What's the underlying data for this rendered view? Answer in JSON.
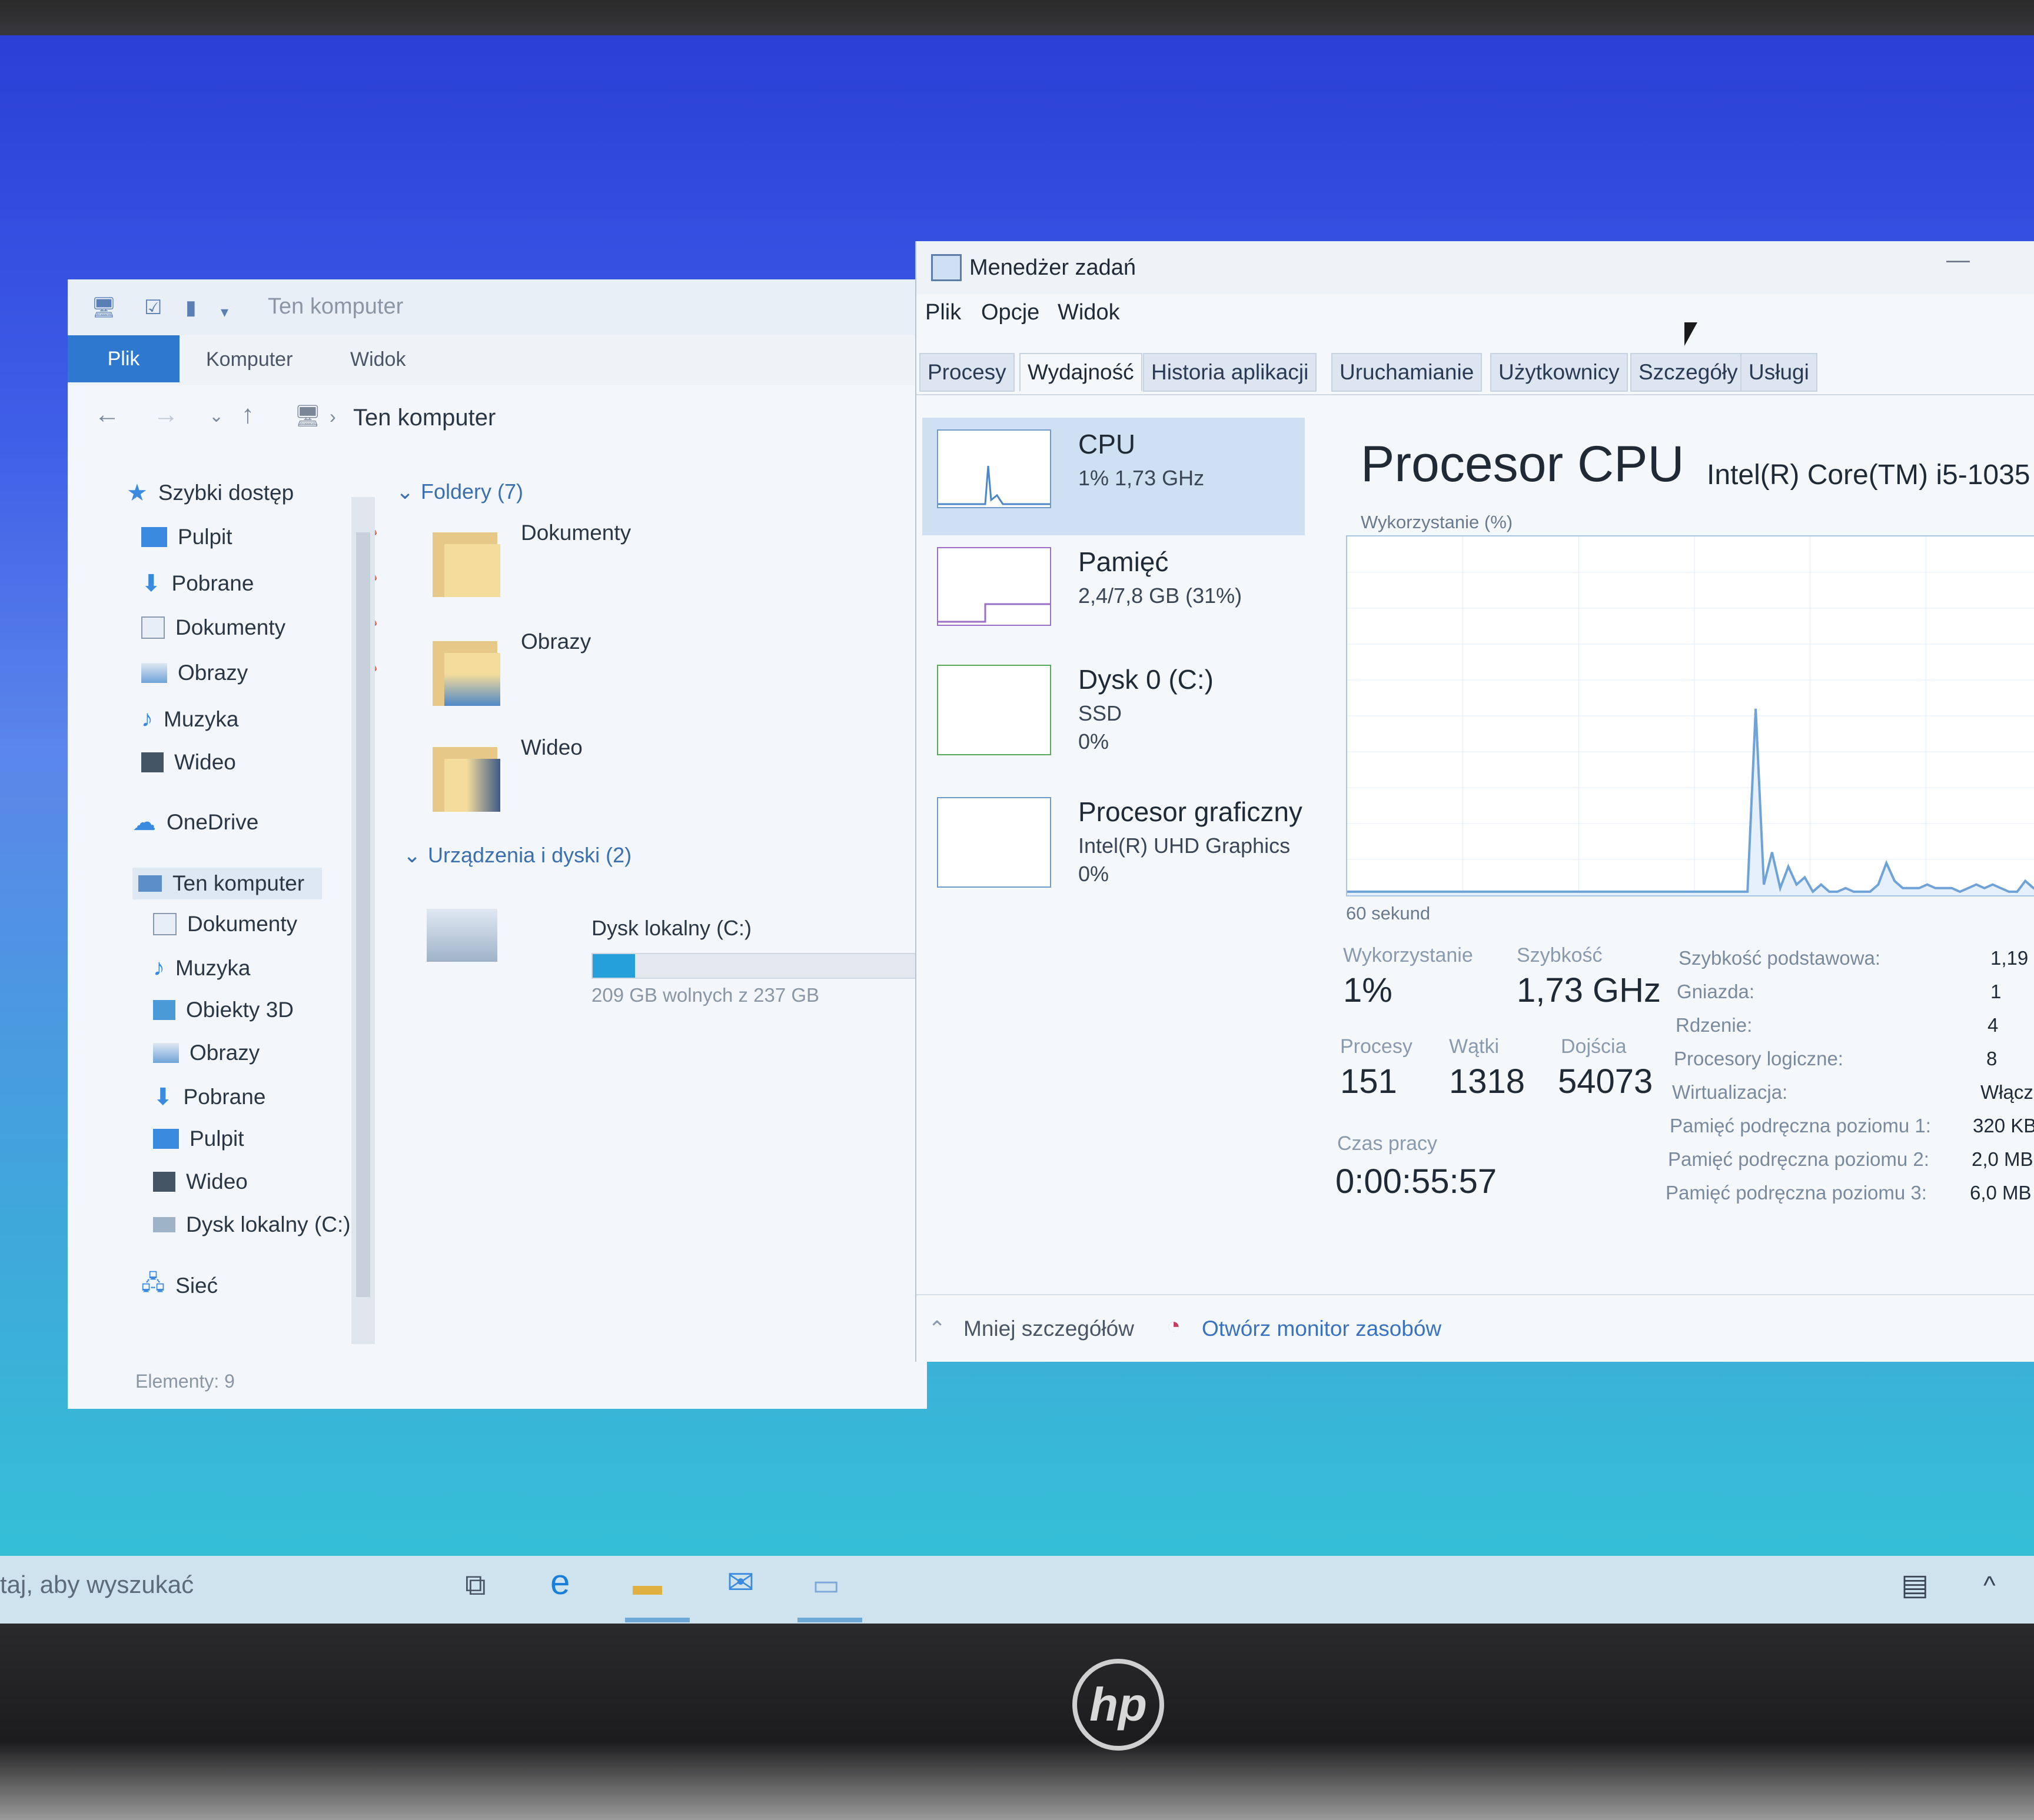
{
  "explorer": {
    "title": "Ten komputer",
    "ribbon_tabs": [
      "Plik",
      "Komputer",
      "Widok"
    ],
    "address_path": "Ten komputer",
    "sidebar": {
      "quick_access": "Szybki dostęp",
      "quick_items": [
        "Pulpit",
        "Pobrane",
        "Dokumenty",
        "Obrazy",
        "Muzyka",
        "Wideo"
      ],
      "onedrive": "OneDrive",
      "this_pc": "Ten komputer",
      "pc_items": [
        "Dokumenty",
        "Muzyka",
        "Obiekty 3D",
        "Obrazy",
        "Pobrane",
        "Pulpit",
        "Wideo",
        "Dysk lokalny (C:)"
      ],
      "network": "Sieć"
    },
    "folders_header": "Foldery (7)",
    "folders": [
      "Dokumenty",
      "Obrazy",
      "Wideo"
    ],
    "devices_header": "Urządzenia i dyski (2)",
    "drive_name": "Dysk lokalny (C:)",
    "drive_free": "209 GB wolnych z 237 GB",
    "drive_used_fraction": 0.12,
    "status": "Elementy: 9"
  },
  "taskmgr": {
    "title": "Menedżer zadań",
    "menu": [
      "Plik",
      "Opcje",
      "Widok"
    ],
    "tabs": [
      "Procesy",
      "Wydajność",
      "Historia aplikacji",
      "Uruchamianie",
      "Użytkownicy",
      "Szczegóły",
      "Usługi"
    ],
    "active_tab": "Wydajność",
    "resources": [
      {
        "name": "CPU",
        "line1": "1% 1,73 GHz",
        "line2": ""
      },
      {
        "name": "Pamięć",
        "line1": "2,4/7,8 GB (31%)",
        "line2": ""
      },
      {
        "name": "Dysk 0 (C:)",
        "line1": "SSD",
        "line2": "0%"
      },
      {
        "name": "Procesor graficzny",
        "line1": "Intel(R) UHD Graphics",
        "line2": "0%"
      }
    ],
    "heading": "Procesor CPU",
    "cpu_model": "Intel(R) Core(TM) i5-1035",
    "util_label": "Wykorzystanie (%)",
    "time_label": "60 sekund",
    "stats": {
      "utilization_label": "Wykorzystanie",
      "utilization": "1%",
      "speed_label": "Szybkość",
      "speed": "1,73 GHz",
      "processes_label": "Procesy",
      "processes": "151",
      "threads_label": "Wątki",
      "threads": "1318",
      "handles_label": "Dojścia",
      "handles": "54073",
      "uptime_label": "Czas pracy",
      "uptime": "0:00:55:57"
    },
    "details": [
      {
        "k": "Szybkość podstawowa:",
        "v": "1,19"
      },
      {
        "k": "Gniazda:",
        "v": "1"
      },
      {
        "k": "Rdzenie:",
        "v": "4"
      },
      {
        "k": "Procesory logiczne:",
        "v": "8"
      },
      {
        "k": "Wirtualizacja:",
        "v": "Włącz"
      },
      {
        "k": "Pamięć podręczna poziomu 1:",
        "v": "320 KB"
      },
      {
        "k": "Pamięć podręczna poziomu 2:",
        "v": "2,0 MB"
      },
      {
        "k": "Pamięć podręczna poziomu 3:",
        "v": "6,0 MB"
      }
    ],
    "footer_less": "Mniej szczegółów",
    "footer_monitor": "Otwórz monitor zasobów",
    "graph_values": [
      1,
      1,
      1,
      1,
      1,
      1,
      1,
      1,
      1,
      1,
      1,
      1,
      1,
      1,
      1,
      1,
      1,
      1,
      1,
      1,
      1,
      1,
      1,
      1,
      1,
      1,
      1,
      1,
      1,
      1,
      1,
      1,
      1,
      1,
      1,
      1,
      1,
      1,
      1,
      1,
      1,
      1,
      1,
      1,
      1,
      1,
      1,
      1,
      1,
      1,
      52,
      3,
      12,
      2,
      8,
      3,
      5,
      1,
      3,
      1,
      1,
      2,
      1,
      1,
      1,
      3,
      9,
      4,
      2,
      2,
      2,
      3,
      2,
      2,
      2,
      1,
      2,
      3,
      2,
      3,
      2,
      1,
      1,
      4,
      2,
      1
    ]
  },
  "taskbar": {
    "search_text": "taj, aby wyszukać"
  },
  "colors": {
    "accent": "#2f78d0",
    "graph": "#6fa3d8",
    "desktop": "#3f5ee8"
  }
}
